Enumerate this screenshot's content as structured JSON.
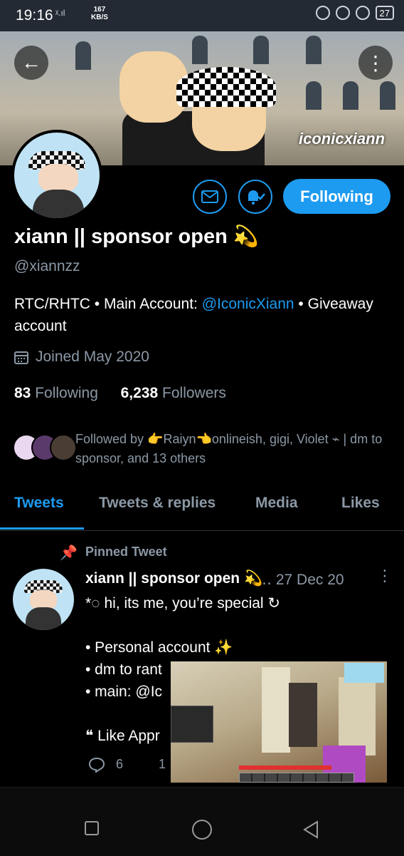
{
  "status_bar": {
    "time": "19:16",
    "network": "ᵡ.ıl",
    "speed_value": "167",
    "speed_unit": "KB/S",
    "battery": "27"
  },
  "banner": {
    "watermark": "iconicxiann"
  },
  "profile": {
    "name": "xiann || sponsor open 💫",
    "handle": "@xiannzz",
    "bio_text_1": "RTC/RHTC • Main Account: ",
    "bio_link": "@IconicXiann",
    "bio_text_2": " • Giveaway account",
    "joined": "Joined May 2020",
    "following_count": "83",
    "following_label": "Following",
    "followers_count": "6,238",
    "followers_label": "Followers",
    "followed_by": "Followed by 👉Raiyn👈onlineish, gigi, Violet ⌁ | dm to sponsor, and 13 others",
    "following_button": "Following"
  },
  "tabs": [
    {
      "label": "Tweets"
    },
    {
      "label": "Tweets & replies"
    },
    {
      "label": "Media"
    },
    {
      "label": "Likes"
    }
  ],
  "tweet": {
    "pinned_label": "Pinned Tweet",
    "author": "xiann || sponsor open 💫",
    "time": "‥ 27 Dec 20",
    "body": "*◌ hi, its me, you’re special ↻\n\n• Personal account ✨\n• dm to rant\n• main: @Ic\n\n❝ Like Appr",
    "reply_count": "6",
    "retweet_count": "1"
  },
  "colors": {
    "accent": "#1d9bf0",
    "muted": "#8b98a5",
    "background": "#000000"
  }
}
